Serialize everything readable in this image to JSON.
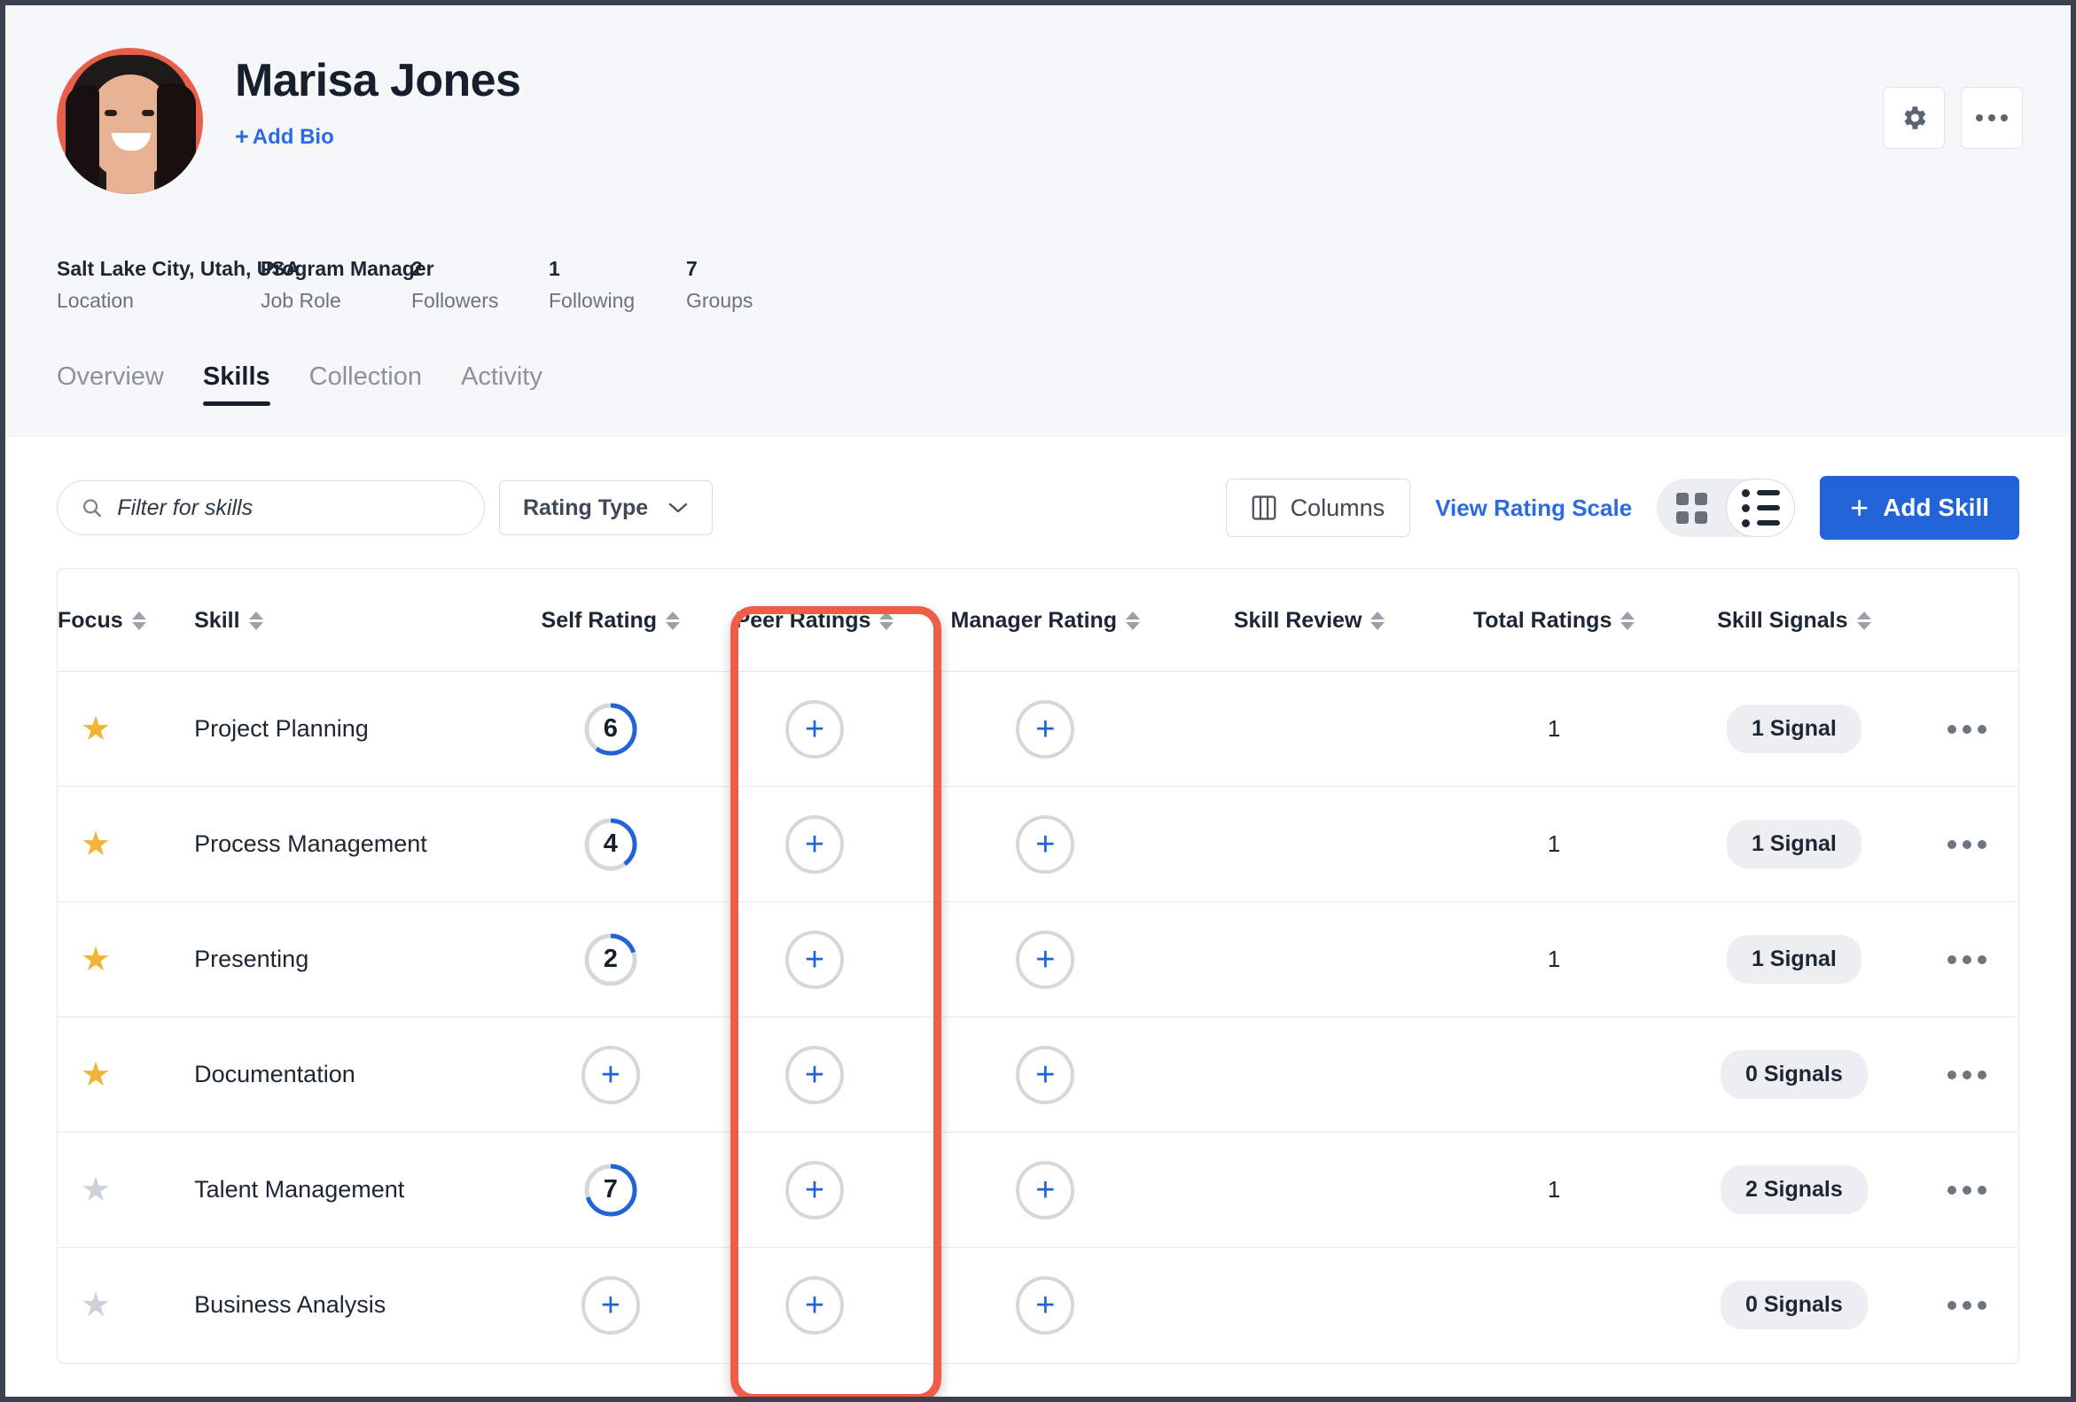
{
  "profile": {
    "name": "Marisa Jones",
    "add_bio_label": "Add Bio",
    "add_bio_plus": "+",
    "avatar_alt": "avatar",
    "actions": {
      "settings_icon": "gear-icon",
      "more_icon": "ellipsis-icon"
    },
    "meta": [
      {
        "value": "Salt Lake City, Utah, USA",
        "label": "Location"
      },
      {
        "value": "Program Manager",
        "label": "Job Role"
      },
      {
        "value": "2",
        "label": "Followers"
      },
      {
        "value": "1",
        "label": "Following"
      },
      {
        "value": "7",
        "label": "Groups"
      }
    ],
    "tabs": [
      {
        "label": "Overview",
        "active": false
      },
      {
        "label": "Skills",
        "active": true
      },
      {
        "label": "Collection",
        "active": false
      },
      {
        "label": "Activity",
        "active": false
      }
    ]
  },
  "toolbar": {
    "search_placeholder": "Filter for skills",
    "search_value": "",
    "search_icon": "search-icon",
    "rating_type_label": "Rating Type",
    "rating_type_caret": "chevron-down-icon",
    "columns_label": "Columns",
    "columns_icon": "columns-icon",
    "view_rating_scale_label": "View Rating Scale",
    "view_grid_icon": "grid-view-icon",
    "view_list_icon": "list-view-icon",
    "view_active": "list",
    "add_skill_label": "Add Skill",
    "add_skill_plus": "+"
  },
  "table": {
    "columns": [
      {
        "label": "Focus",
        "sortable": true
      },
      {
        "label": "Skill",
        "sortable": true
      },
      {
        "label": "Self Rating",
        "sortable": true
      },
      {
        "label": "Peer Ratings",
        "sortable": true
      },
      {
        "label": "Manager Rating",
        "sortable": true
      },
      {
        "label": "Skill Review",
        "sortable": true
      },
      {
        "label": "Total Ratings",
        "sortable": true
      },
      {
        "label": "Skill Signals",
        "sortable": true
      }
    ],
    "rating_max": 10,
    "add_glyph": "+",
    "rows": [
      {
        "focus": true,
        "skill": "Project Planning",
        "self_rating": "6",
        "peer_ratings": "",
        "manager_rating": "",
        "skill_review": "",
        "total_ratings": "1",
        "skill_signals": "1 Signal"
      },
      {
        "focus": true,
        "skill": "Process Management",
        "self_rating": "4",
        "peer_ratings": "",
        "manager_rating": "",
        "skill_review": "",
        "total_ratings": "1",
        "skill_signals": "1 Signal"
      },
      {
        "focus": true,
        "skill": "Presenting",
        "self_rating": "2",
        "peer_ratings": "",
        "manager_rating": "",
        "skill_review": "",
        "total_ratings": "1",
        "skill_signals": "1 Signal"
      },
      {
        "focus": true,
        "skill": "Documentation",
        "self_rating": "",
        "peer_ratings": "",
        "manager_rating": "",
        "skill_review": "",
        "total_ratings": "",
        "skill_signals": "0 Signals"
      },
      {
        "focus": false,
        "skill": "Talent Management",
        "self_rating": "7",
        "peer_ratings": "",
        "manager_rating": "",
        "skill_review": "",
        "total_ratings": "1",
        "skill_signals": "2 Signals"
      },
      {
        "focus": false,
        "skill": "Business Analysis",
        "self_rating": "",
        "peer_ratings": "",
        "manager_rating": "",
        "skill_review": "",
        "total_ratings": "",
        "skill_signals": "0 Signals"
      }
    ]
  },
  "annotation": {
    "highlight_column": "Peer Ratings",
    "color": "#ef5c47"
  }
}
